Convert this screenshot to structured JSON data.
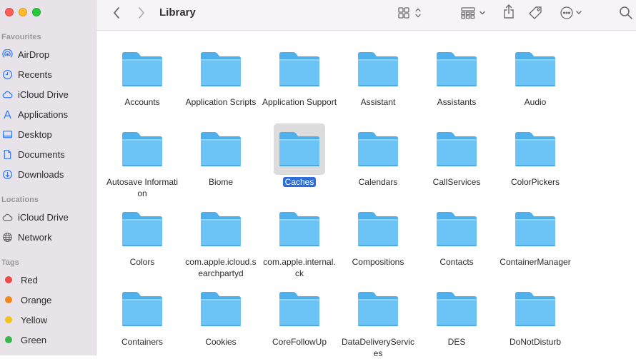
{
  "window": {
    "title": "Library"
  },
  "sidebar": {
    "favourites_title": "Favourites",
    "favourites": [
      {
        "label": "AirDrop",
        "icon": "airdrop-icon"
      },
      {
        "label": "Recents",
        "icon": "clock-icon"
      },
      {
        "label": "iCloud Drive",
        "icon": "cloud-icon"
      },
      {
        "label": "Applications",
        "icon": "applications-icon"
      },
      {
        "label": "Desktop",
        "icon": "desktop-icon"
      },
      {
        "label": "Documents",
        "icon": "document-icon"
      },
      {
        "label": "Downloads",
        "icon": "download-icon"
      }
    ],
    "locations_title": "Locations",
    "locations": [
      {
        "label": "iCloud Drive",
        "icon": "cloud-icon"
      },
      {
        "label": "Network",
        "icon": "globe-icon"
      }
    ],
    "tags_title": "Tags",
    "tags": [
      {
        "label": "Red",
        "color": "#ef4a45"
      },
      {
        "label": "Orange",
        "color": "#f0881a"
      },
      {
        "label": "Yellow",
        "color": "#f3c318"
      },
      {
        "label": "Green",
        "color": "#34b94a"
      }
    ]
  },
  "toolbar": {
    "icons": [
      "back-icon",
      "forward-icon",
      "icon-view-icon",
      "group-icon",
      "share-icon",
      "tag-icon",
      "more-icon",
      "search-icon"
    ]
  },
  "folders": [
    [
      "Accounts",
      "Application Scripts",
      "Application Support",
      "Assistant",
      "Assistants",
      "Audio"
    ],
    [
      "Autosave Information",
      "Biome",
      "Caches",
      "Calendars",
      "CallServices",
      "ColorPickers"
    ],
    [
      "Colors",
      "com.apple.icloud.searchpartyd",
      "com.apple.internal.ck",
      "Compositions",
      "Contacts",
      "ContainerManager"
    ],
    [
      "Containers",
      "Cookies",
      "CoreFollowUp",
      "DataDeliveryServices",
      "DES",
      "DoNotDisturb"
    ]
  ],
  "selected_folder": "Caches",
  "colors": {
    "accent": "#2f6ed8",
    "folder": "#6cc3f5",
    "folder_dark": "#4fb0ec"
  }
}
